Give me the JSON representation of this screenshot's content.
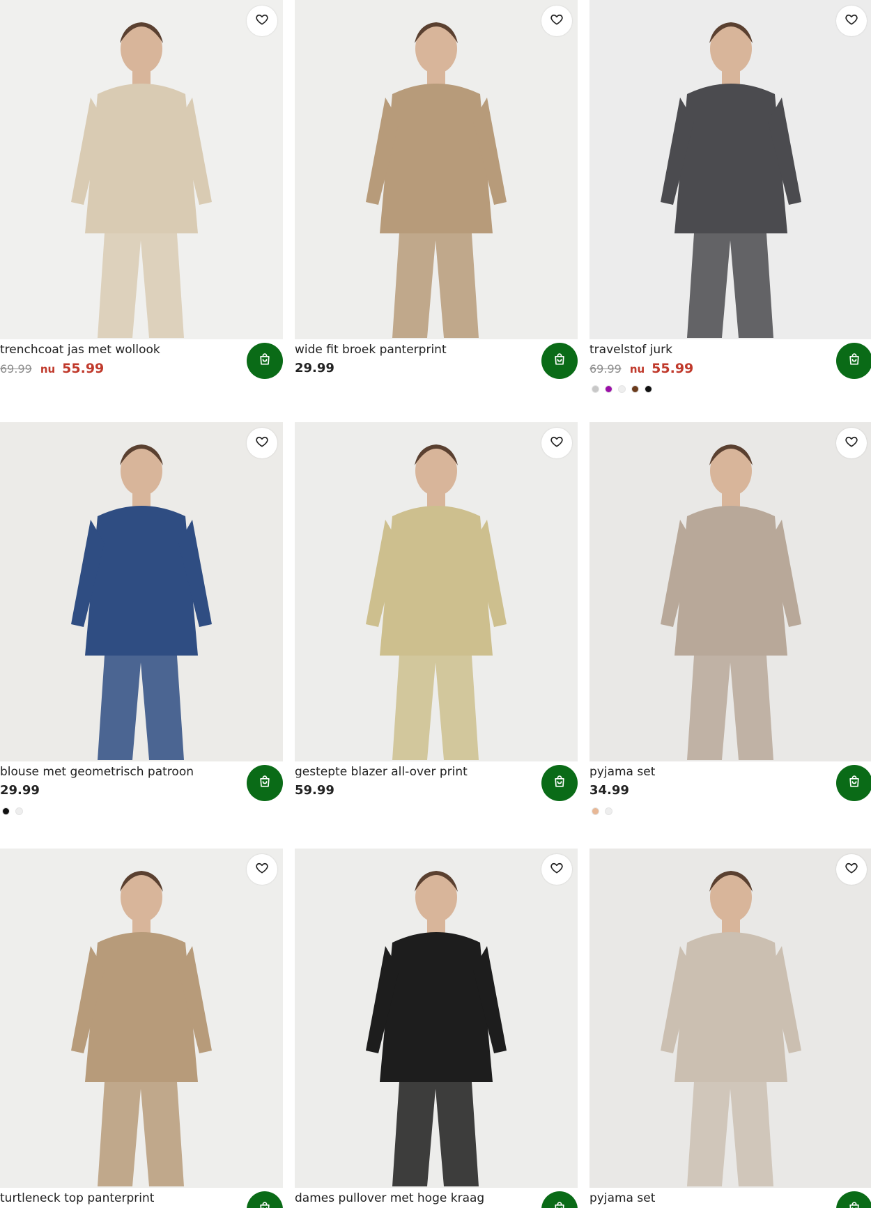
{
  "products": [
    {
      "title": "trenchcoat jas met wollook",
      "old_price": "69.99",
      "now_label": "nu",
      "price": "55.99",
      "on_sale": true,
      "swatches": [],
      "image": "trench-coat-photo",
      "bg": "#f0f0ee",
      "accent": "#d9cbb3"
    },
    {
      "title": "wide fit broek panterprint",
      "old_price": "",
      "now_label": "",
      "price": "29.99",
      "on_sale": false,
      "swatches": [],
      "image": "leopard-trousers-photo",
      "bg": "#eeeeec",
      "accent": "#b79b7a"
    },
    {
      "title": "travelstof jurk",
      "old_price": "69.99",
      "now_label": "nu",
      "price": "55.99",
      "on_sale": true,
      "swatches": [
        "#c8c8c8",
        "#9b0fa8",
        "#eeeeee",
        "#6b3b1c",
        "#111111"
      ],
      "image": "grey-dress-photo",
      "bg": "#ececec",
      "accent": "#4b4b4f"
    },
    {
      "title": "blouse met geometrisch patroon",
      "old_price": "",
      "now_label": "",
      "price": "29.99",
      "on_sale": false,
      "swatches": [
        "#111111",
        "#eeeeee"
      ],
      "image": "geometric-blouse-photo",
      "bg": "#ecebe8",
      "accent": "#2f4d82"
    },
    {
      "title": "gestepte blazer all-over print",
      "old_price": "",
      "now_label": "",
      "price": "59.99",
      "on_sale": false,
      "swatches": [],
      "image": "printed-blazer-photo",
      "bg": "#ededeb",
      "accent": "#cdbf8e"
    },
    {
      "title": "pyjama set",
      "old_price": "",
      "now_label": "",
      "price": "34.99",
      "on_sale": false,
      "swatches": [
        "#e8b896",
        "#eeeeee"
      ],
      "image": "pyjama-set-photo",
      "bg": "#e9e8e6",
      "accent": "#b8a899"
    },
    {
      "title": "turtleneck top panterprint",
      "old_price": "",
      "now_label": "",
      "price": "",
      "on_sale": false,
      "swatches": [],
      "image": "leopard-top-photo",
      "bg": "#eeeeec",
      "accent": "#b79b7a"
    },
    {
      "title": "dames pullover met hoge kraag",
      "old_price": "",
      "now_label": "",
      "price": "",
      "on_sale": false,
      "swatches": [],
      "image": "black-pullover-photo",
      "bg": "#ededeb",
      "accent": "#1d1d1d"
    },
    {
      "title": "pyjama set",
      "old_price": "",
      "now_label": "",
      "price": "",
      "on_sale": false,
      "swatches": [],
      "image": "lounge-pyjama-photo",
      "bg": "#e9e8e6",
      "accent": "#cbbfb1"
    }
  ],
  "icons": {
    "favorite": "heart-icon",
    "cart": "shopping-bag-icon"
  },
  "colors": {
    "cart_button": "#0a6b17",
    "sale_price": "#c0392b",
    "old_price": "#8b8b8b"
  }
}
